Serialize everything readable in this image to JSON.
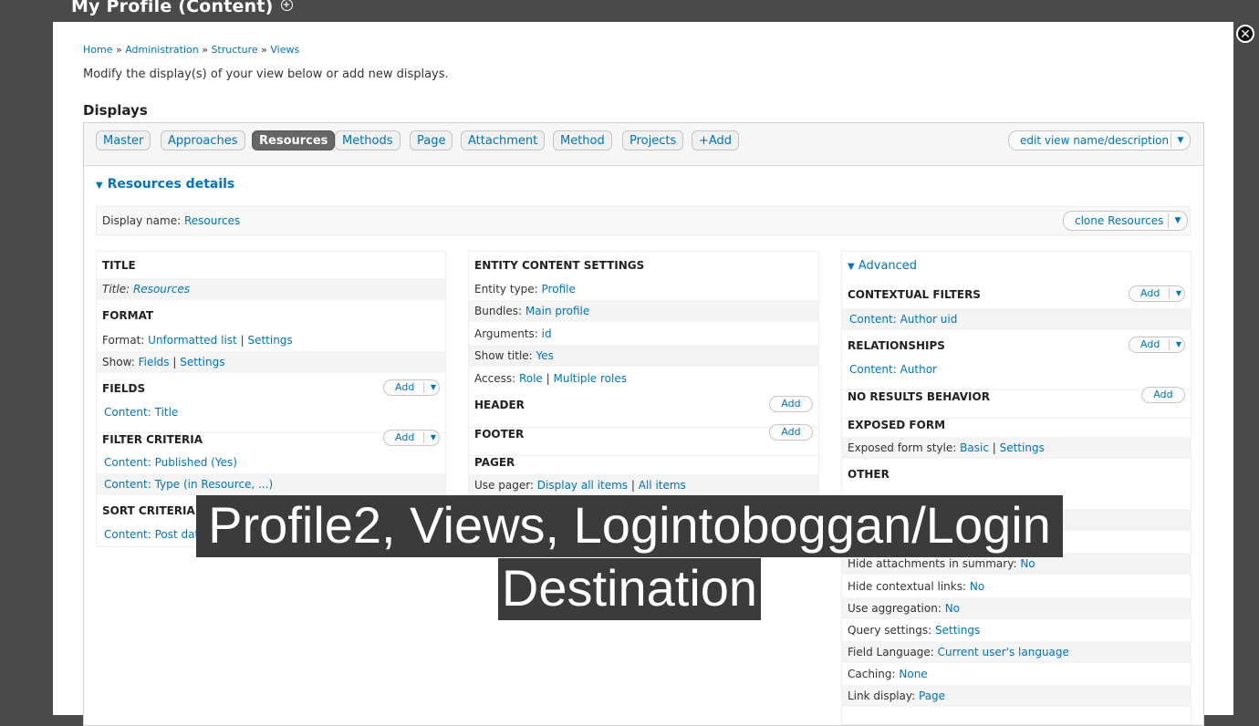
{
  "window": {
    "title": "My Profile (Content)",
    "close_symbol": "✕",
    "plus_symbol": "+"
  },
  "breadcrumb": [
    {
      "label": "Home"
    },
    {
      "sep": "»"
    },
    {
      "label": "Administration"
    },
    {
      "sep": "»"
    },
    {
      "label": "Structure"
    },
    {
      "sep": "»"
    },
    {
      "label": "Views"
    }
  ],
  "intro": "Modify the display(s) of your view below or add new displays.",
  "displays_heading": "Displays",
  "tabs": [
    {
      "label": "Master"
    },
    {
      "label": "Approaches"
    },
    {
      "label": "Resources"
    },
    {
      "label": "Methods"
    },
    {
      "label": "Page"
    },
    {
      "label": "Attachment"
    },
    {
      "label": "Method"
    },
    {
      "label": "Projects"
    },
    {
      "label": "+Add"
    }
  ],
  "edit_view_btn": "edit view name/description",
  "details_heading": "Resources details",
  "display_name": {
    "label": "Display name:",
    "value": "Resources"
  },
  "clone_btn": "clone Resources",
  "col1": {
    "title_h": "TITLE",
    "title_label": "Title:",
    "title_value": "Resources",
    "format_h": "FORMAT",
    "format_label": "Format:",
    "format_value": "Unformatted list",
    "format_sep": "|",
    "format_settings": "Settings",
    "show_label": "Show:",
    "show_value": "Fields",
    "show_sep": "|",
    "show_settings": "Settings",
    "fields_h": "FIELDS",
    "fields_add": "Add",
    "field_1": "Content: Title",
    "filter_h": "FILTER CRITERIA",
    "filter_add": "Add",
    "filter_1": "Content: Published (Yes)",
    "filter_2": "Content: Type (in Resource, ...)",
    "sort_h": "SORT CRITERIA",
    "sort_1": "Content: Post dat"
  },
  "col2": {
    "entity_h": "ENTITY CONTENT SETTINGS",
    "entity_type_label": "Entity type:",
    "entity_type_value": "Profile",
    "bundles_label": "Bundles:",
    "bundles_value": "Main profile",
    "arguments_label": "Arguments:",
    "arguments_value": "id",
    "show_title_label": "Show title:",
    "show_title_value": "Yes",
    "access_label": "Access:",
    "access_value": "Role",
    "access_sep": "|",
    "access_value2": "Multiple roles",
    "header_h": "HEADER",
    "header_add": "Add",
    "footer_h": "FOOTER",
    "footer_add": "Add",
    "pager_h": "PAGER",
    "pager_label": "Use pager:",
    "pager_value": "Display all items",
    "pager_sep": "|",
    "pager_value2": "All items"
  },
  "col3": {
    "advanced_h": "Advanced",
    "ctx_h": "CONTEXTUAL FILTERS",
    "ctx_add": "Add",
    "ctx_1": "Content: Author uid",
    "rel_h": "RELATIONSHIPS",
    "rel_add": "Add",
    "rel_1": "Content: Author",
    "nores_h": "NO RESULTS BEHAVIOR",
    "nores_add": "Add",
    "exposed_h": "EXPOSED FORM",
    "exposed_label": "Exposed form style:",
    "exposed_value": "Basic",
    "exposed_sep": "|",
    "exposed_settings": "Settings",
    "other_h": "OTHER",
    "hide_att_label": "Hide attachments in summary:",
    "hide_att_value": "No",
    "hide_ctx_label": "Hide contextual links:",
    "hide_ctx_value": "No",
    "agg_label": "Use aggregation:",
    "agg_value": "No",
    "query_label": "Query settings:",
    "query_value": "Settings",
    "lang_label": "Field Language:",
    "lang_value": "Current user's language",
    "cache_label": "Caching:",
    "cache_value": "None",
    "link_label": "Link display:",
    "link_value": "Page"
  },
  "caption": {
    "line1": "Profile2, Views, Logintoboggan/Login",
    "line2": "Destination"
  }
}
